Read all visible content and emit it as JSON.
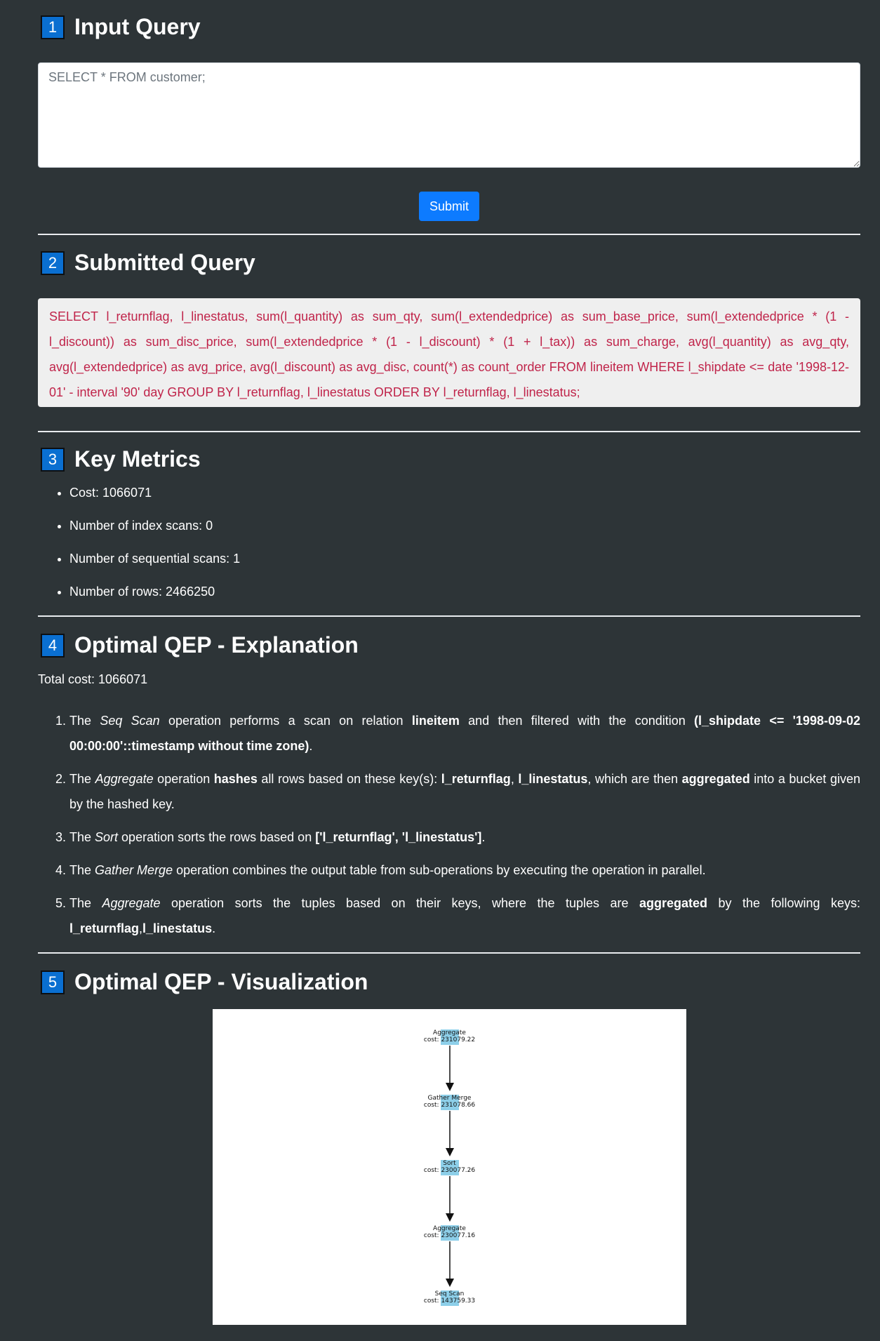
{
  "sections": {
    "s1": {
      "num": "1",
      "title": "Input Query"
    },
    "s2": {
      "num": "2",
      "title": "Submitted Query"
    },
    "s3": {
      "num": "3",
      "title": "Key Metrics"
    },
    "s4": {
      "num": "4",
      "title": "Optimal QEP - Explanation"
    },
    "s5": {
      "num": "5",
      "title": "Optimal QEP - Visualization"
    }
  },
  "input": {
    "placeholder": "SELECT * FROM customer;",
    "submit_label": "Submit"
  },
  "submitted_query": "SELECT l_returnflag, l_linestatus, sum(l_quantity) as sum_qty, sum(l_extendedprice) as sum_base_price, sum(l_extendedprice * (1 - l_discount)) as sum_disc_price, sum(l_extendedprice * (1 - l_discount) * (1 + l_tax)) as sum_charge, avg(l_quantity) as avg_qty, avg(l_extendedprice) as avg_price, avg(l_discount) as avg_disc, count(*) as count_order FROM lineitem WHERE l_shipdate <= date '1998-12-01' - interval '90' day GROUP BY l_returnflag, l_linestatus ORDER BY l_returnflag, l_linestatus;",
  "metrics": [
    "Cost: 1066071",
    "Number of index scans: 0",
    "Number of sequential scans: 1",
    "Number of rows: 2466250"
  ],
  "explanation": {
    "total_cost": "Total cost: 1066071",
    "items": [
      {
        "a": "The ",
        "op": "Seq Scan",
        "b": " operation performs a scan on relation ",
        "c": "lineitem",
        "d": " and then filtered with the condition ",
        "e": "(l_shipdate <= '1998-09-02 00:00:00'::timestamp without time zone)",
        "f": "."
      },
      {
        "a": "The ",
        "op": "Aggregate",
        "b": " operation ",
        "c": "hashes",
        "d": " all rows based on these key(s): ",
        "e": "l_returnflag",
        "f": ", ",
        "g": "l_linestatus",
        "h": ", which are then ",
        "i": "aggregated",
        "j": " into a bucket given by the hashed key."
      },
      {
        "a": "The ",
        "op": "Sort",
        "b": " operation sorts the rows based on ",
        "c": "['l_returnflag', 'l_linestatus']",
        "d": "."
      },
      {
        "a": "The ",
        "op": "Gather Merge",
        "b": " operation combines the output table from sub-operations by executing the operation in parallel."
      },
      {
        "a": "The ",
        "op": "Aggregate",
        "b": " operation sorts the tuples based on their keys, where the tuples are ",
        "c": "aggregated",
        "d": " by the following keys: ",
        "e": "l_returnflag",
        "f": ",",
        "g": "l_linestatus",
        "h": "."
      }
    ]
  },
  "visualization": {
    "nodes": [
      {
        "name": "Aggregate",
        "cost": "cost: 231079.22"
      },
      {
        "name": "Gather Merge",
        "cost": "cost: 231078.66"
      },
      {
        "name": "Sort",
        "cost": "cost: 230077.26"
      },
      {
        "name": "Aggregate",
        "cost": "cost: 230077.16"
      },
      {
        "name": "Seq Scan",
        "cost": "cost: 143759.33"
      }
    ]
  }
}
